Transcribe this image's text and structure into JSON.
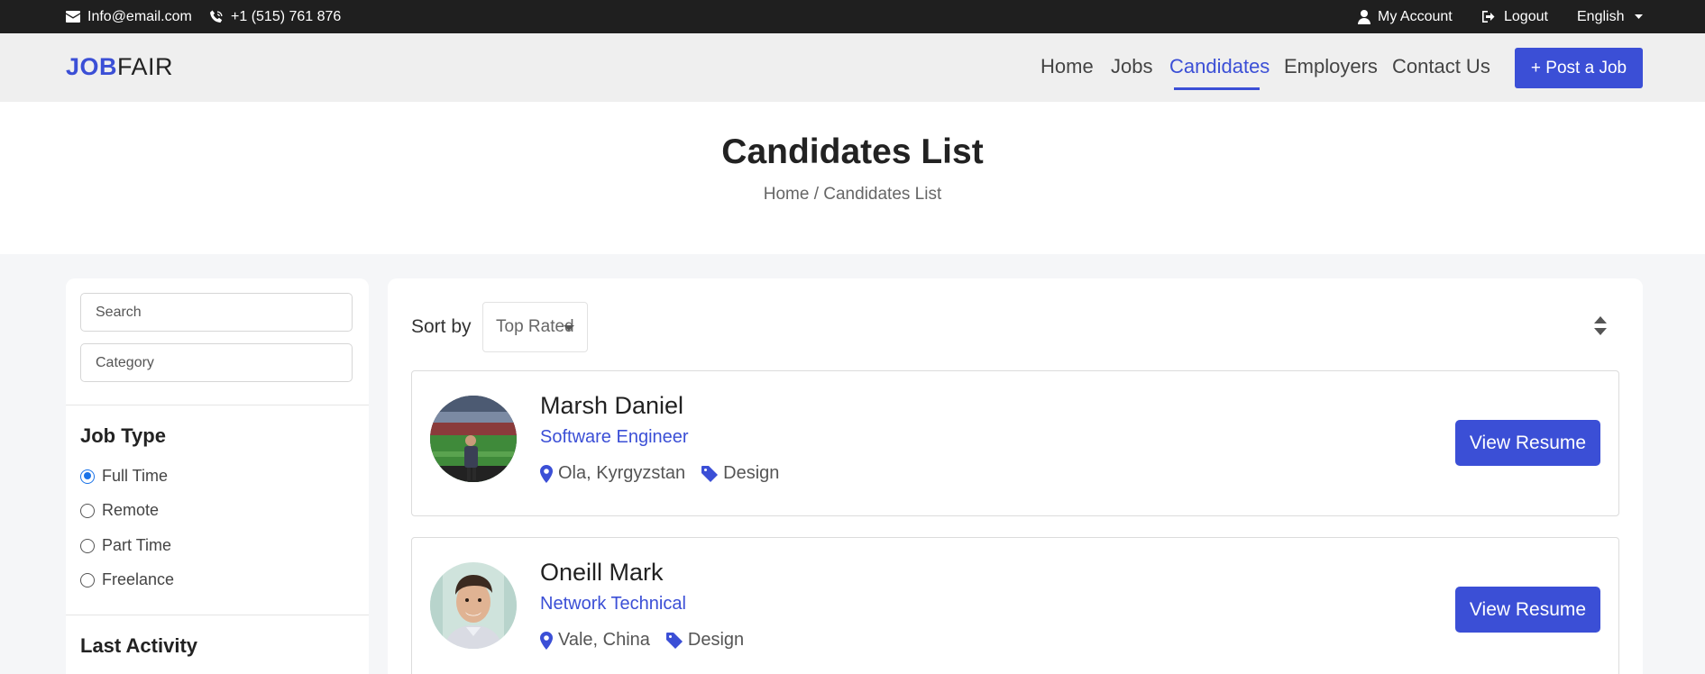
{
  "topbar": {
    "email": "Info@email.com",
    "phone": "+1 (515) 761 876",
    "my_account": "My Account",
    "logout": "Logout",
    "language": "English"
  },
  "nav": {
    "logo_bold": "JOB",
    "logo_regular": "FAIR",
    "links": [
      "Home",
      "Jobs",
      "Candidates",
      "Employers",
      "Contact Us"
    ],
    "active": "Candidates",
    "post_button": "+ Post a Job"
  },
  "hero": {
    "title": "Candidates List",
    "breadcrumb": "Home / Candidates List"
  },
  "sidebar": {
    "search_placeholder": "Search",
    "category_placeholder": "Category",
    "job_type_heading": "Job Type",
    "job_types": [
      "Full Time",
      "Remote",
      "Part Time",
      "Freelance"
    ],
    "job_type_selected": "Full Time",
    "last_activity_heading": "Last Activity"
  },
  "main": {
    "sort_label": "Sort by",
    "sort_value": "Top Rated",
    "view_button": "View Resume",
    "candidates": [
      {
        "name": "Marsh Daniel",
        "role": "Software Engineer",
        "location": "Ola, Kyrgyzstan",
        "category": "Design"
      },
      {
        "name": "Oneill Mark",
        "role": "Network Technical",
        "location": "Vale, China",
        "category": "Design"
      }
    ]
  },
  "colors": {
    "accent": "#3b4fd6",
    "topbar_bg": "#1f1f1f",
    "nav_bg": "#efefef"
  }
}
